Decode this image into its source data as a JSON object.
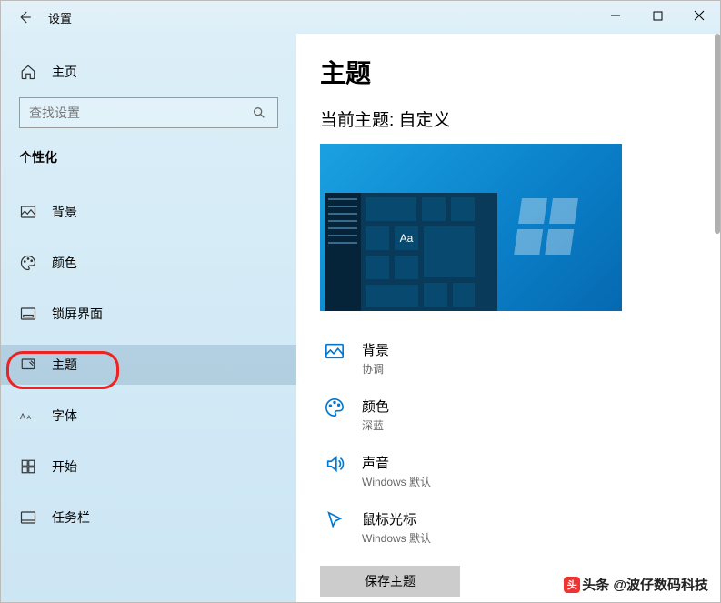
{
  "titlebar": {
    "title": "设置"
  },
  "sidebar": {
    "home_label": "主页",
    "search_placeholder": "查找设置",
    "category_label": "个性化",
    "items": [
      {
        "label": "背景"
      },
      {
        "label": "颜色"
      },
      {
        "label": "锁屏界面"
      },
      {
        "label": "主题"
      },
      {
        "label": "字体"
      },
      {
        "label": "开始"
      },
      {
        "label": "任务栏"
      }
    ]
  },
  "content": {
    "page_title": "主题",
    "subtitle": "当前主题: 自定义",
    "preview_text": "Aa",
    "settings": [
      {
        "label": "背景",
        "value": "协调"
      },
      {
        "label": "颜色",
        "value": "深蓝"
      },
      {
        "label": "声音",
        "value": "Windows 默认"
      },
      {
        "label": "鼠标光标",
        "value": "Windows 默认"
      }
    ],
    "save_button": "保存主题"
  },
  "watermark": "头条 @波仔数码科技"
}
